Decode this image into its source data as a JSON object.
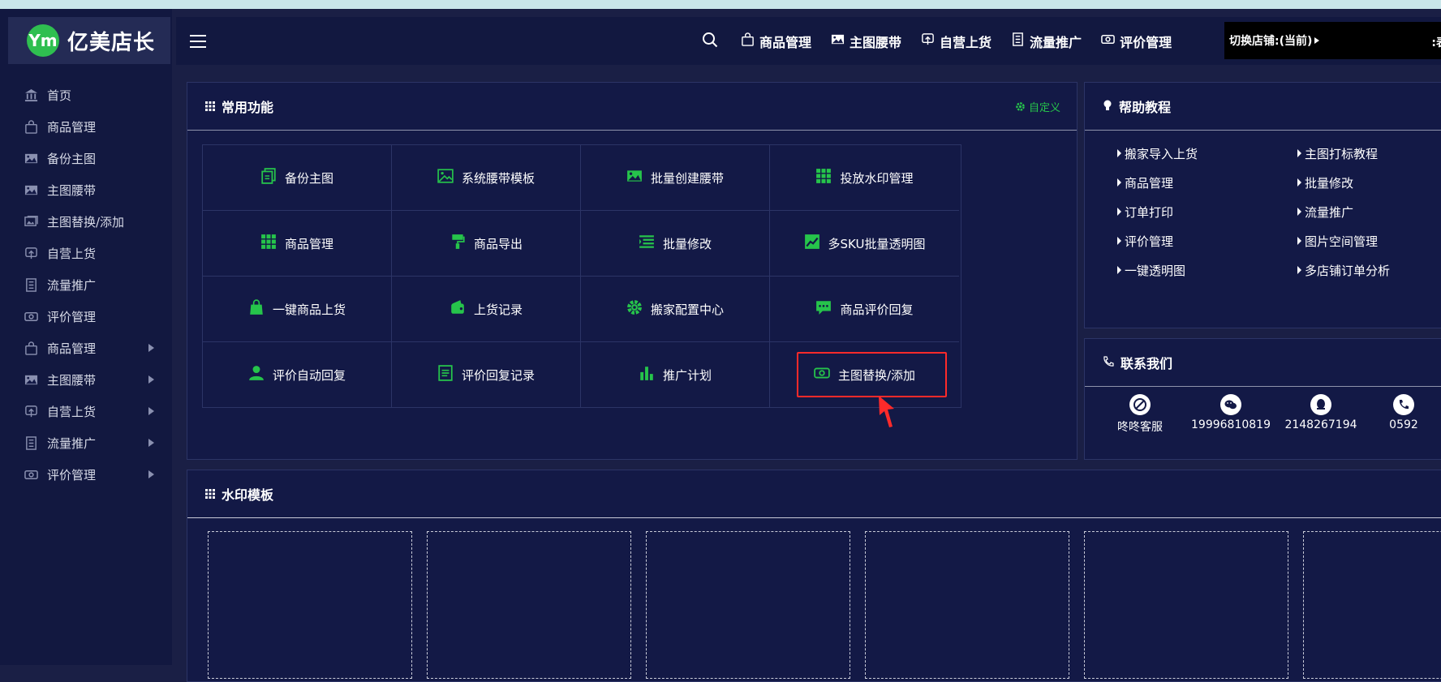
{
  "brand": {
    "logo_text": "Ym",
    "name": "亿美店长"
  },
  "sidebar": {
    "items": [
      {
        "label": "首页",
        "icon": "bank-icon",
        "expandable": false
      },
      {
        "label": "商品管理",
        "icon": "bag-icon",
        "expandable": false
      },
      {
        "label": "备份主图",
        "icon": "image-icon",
        "expandable": false
      },
      {
        "label": "主图腰带",
        "icon": "image-icon",
        "expandable": false
      },
      {
        "label": "主图替换/添加",
        "icon": "images-icon",
        "expandable": false
      },
      {
        "label": "自营上货",
        "icon": "upload-icon",
        "expandable": false
      },
      {
        "label": "流量推广",
        "icon": "list-icon",
        "expandable": false
      },
      {
        "label": "评价管理",
        "icon": "ticket-icon",
        "expandable": false
      },
      {
        "label": "商品管理",
        "icon": "bag-icon",
        "expandable": true
      },
      {
        "label": "主图腰带",
        "icon": "image-icon",
        "expandable": true
      },
      {
        "label": "自营上货",
        "icon": "upload-icon",
        "expandable": true
      },
      {
        "label": "流量推广",
        "icon": "list-icon",
        "expandable": true
      },
      {
        "label": "评价管理",
        "icon": "ticket-icon",
        "expandable": true
      }
    ]
  },
  "header": {
    "nav": [
      {
        "label": "商品管理",
        "icon": "bag-icon"
      },
      {
        "label": "主图腰带",
        "icon": "image-icon"
      },
      {
        "label": "自营上货",
        "icon": "upload-icon"
      },
      {
        "label": "流量推广",
        "icon": "list-icon"
      },
      {
        "label": "评价管理",
        "icon": "ticket-icon"
      }
    ],
    "shop_switch_label": "切换店铺:(当前)",
    "shop_switch_trail": ":表"
  },
  "common_functions": {
    "title": "常用功能",
    "customize_label": "自定义",
    "items": [
      {
        "label": "备份主图",
        "icon": "copy-icon"
      },
      {
        "label": "系统腰带模板",
        "icon": "image-outline-icon"
      },
      {
        "label": "批量创建腰带",
        "icon": "image-icon"
      },
      {
        "label": "投放水印管理",
        "icon": "grid-icon"
      },
      {
        "label": "商品管理",
        "icon": "grid-icon"
      },
      {
        "label": "商品导出",
        "icon": "paint-roller-icon"
      },
      {
        "label": "批量修改",
        "icon": "indent-icon"
      },
      {
        "label": "多SKU批量透明图",
        "icon": "line-chart-icon"
      },
      {
        "label": "一键商品上货",
        "icon": "shopping-bag-icon"
      },
      {
        "label": "上货记录",
        "icon": "wallet-icon"
      },
      {
        "label": "搬家配置中心",
        "icon": "gear-icon"
      },
      {
        "label": "商品评价回复",
        "icon": "comment-icon"
      },
      {
        "label": "评价自动回复",
        "icon": "user-icon"
      },
      {
        "label": "评价回复记录",
        "icon": "document-icon"
      },
      {
        "label": "推广计划",
        "icon": "bar-chart-icon"
      },
      {
        "label": "主图替换/添加",
        "icon": "ticket-icon"
      }
    ],
    "highlighted_item": "主图替换/添加"
  },
  "help": {
    "title": "帮助教程",
    "items": [
      "搬家导入上货",
      "主图打标教程",
      "商品管理",
      "批量修改",
      "订单打印",
      "流量推广",
      "评价管理",
      "图片空间管理",
      "一键透明图",
      "多店铺订单分析"
    ]
  },
  "contact": {
    "title": "联系我们",
    "items": [
      {
        "label": "咚咚客服",
        "icon": "dongdong-icon"
      },
      {
        "label": "19996810819",
        "icon": "wechat-icon"
      },
      {
        "label": "2148267194",
        "icon": "qq-icon"
      },
      {
        "label": "0592",
        "icon": "phone-icon"
      }
    ]
  },
  "watermark": {
    "title": "水印模板",
    "box_count": 6
  },
  "colors": {
    "accent_green": "#26c44b",
    "highlight_red": "#ff2a2a",
    "panel_bg": "#131946",
    "page_bg": "#1a1f45"
  }
}
